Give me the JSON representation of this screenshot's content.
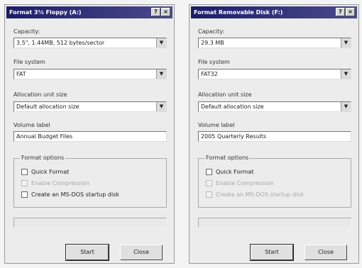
{
  "dialogs": [
    {
      "title": "Format 3½ Floppy (A:)",
      "capacity_label": "Capacity:",
      "capacity_value": "3.5\", 1.44MB, 512 bytes/sector",
      "fs_label": "File system",
      "fs_value": "FAT",
      "alloc_label": "Allocation unit size",
      "alloc_value": "Default allocation size",
      "volume_label": "Volume label",
      "volume_value": "Annual Budget Files",
      "options_title": "Format options",
      "options": [
        {
          "label": "Quick Format",
          "enabled": true
        },
        {
          "label": "Enable Compression",
          "enabled": false
        },
        {
          "label": "Create an MS-DOS startup disk",
          "enabled": true
        }
      ],
      "start_label": "Start",
      "close_label": "Close"
    },
    {
      "title": "Format Removable Disk (F:)",
      "capacity_label": "Capacity:",
      "capacity_value": "29.3 MB",
      "fs_label": "File system",
      "fs_value": "FAT32",
      "alloc_label": "Allocation unit size",
      "alloc_value": "Default allocation size",
      "volume_label": "Volume label",
      "volume_value": "2005 Quarterly Results",
      "options_title": "Format options",
      "options": [
        {
          "label": "Quick Format",
          "enabled": true
        },
        {
          "label": "Enable Compression",
          "enabled": false
        },
        {
          "label": "Create an MS-DOS startup disk",
          "enabled": false
        }
      ],
      "start_label": "Start",
      "close_label": "Close"
    }
  ],
  "titlebar_buttons": {
    "help": "?",
    "close": "×"
  },
  "combo_arrow": "▼"
}
